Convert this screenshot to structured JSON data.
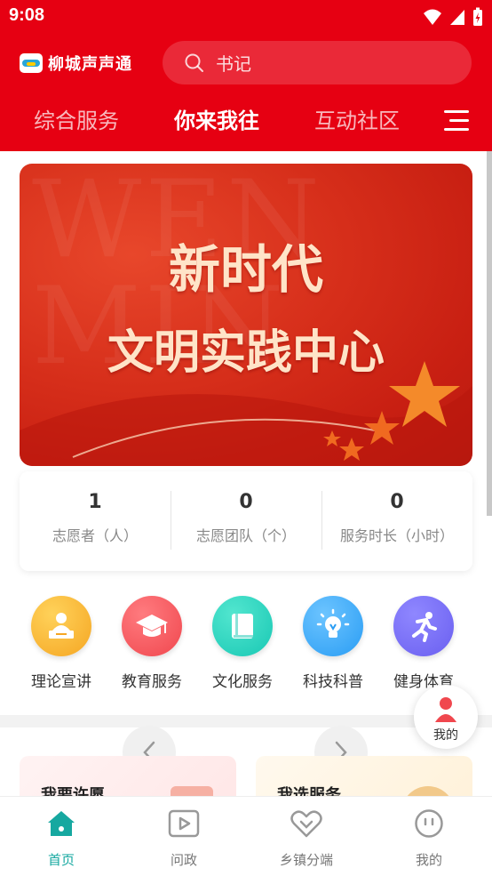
{
  "status_bar": {
    "time": "9:08"
  },
  "header": {
    "app_name": "柳城声声通",
    "search_placeholder": "书记",
    "tabs": [
      {
        "label": "综合服务",
        "active": false
      },
      {
        "label": "你来我往",
        "active": true
      },
      {
        "label": "互动社区",
        "active": false
      }
    ]
  },
  "banner": {
    "line1": "新时代",
    "line2": "文明实践中心",
    "bg_letters": "WEN MIN"
  },
  "stats": [
    {
      "value": "1",
      "label": "志愿者（人）"
    },
    {
      "value": "0",
      "label": "志愿团队（个）"
    },
    {
      "value": "0",
      "label": "服务时长（小时）"
    }
  ],
  "services": [
    {
      "label": "理论宣讲",
      "icon": "lecture-icon",
      "color": "#f5a623"
    },
    {
      "label": "教育服务",
      "icon": "graduation-cap-icon",
      "color": "#f0474e"
    },
    {
      "label": "文化服务",
      "icon": "book-icon",
      "color": "#19c8b4"
    },
    {
      "label": "科技科普",
      "icon": "lightbulb-icon",
      "color": "#2a9df4"
    },
    {
      "label": "健身体育",
      "icon": "runner-icon",
      "color": "#6a5ff0"
    }
  ],
  "floating": {
    "label": "我的"
  },
  "cards": [
    {
      "title": "我要许愿"
    },
    {
      "title": "我选服务"
    }
  ],
  "bottom_nav": [
    {
      "label": "首页",
      "icon": "home-icon",
      "active": true
    },
    {
      "label": "问政",
      "icon": "play-box-icon",
      "active": false
    },
    {
      "label": "乡镇分端",
      "icon": "heart-link-icon",
      "active": false
    },
    {
      "label": "我的",
      "icon": "face-icon",
      "active": false
    }
  ],
  "colors": {
    "brand_red": "#e60012",
    "active_teal": "#16a8a0"
  }
}
